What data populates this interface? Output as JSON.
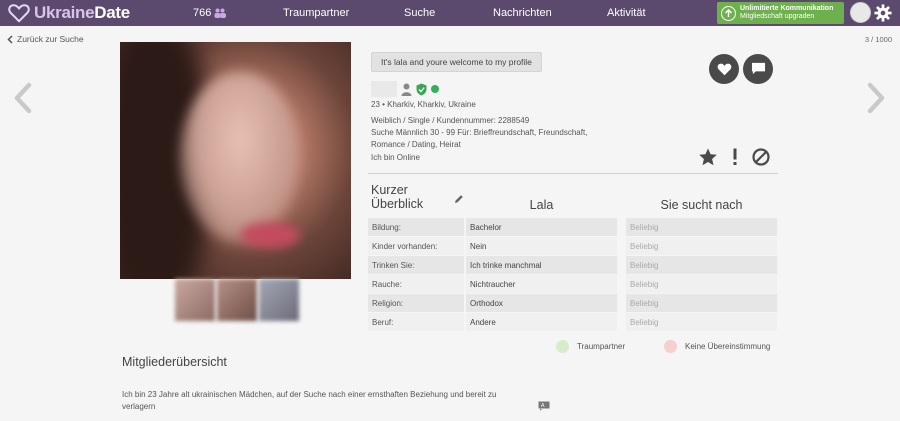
{
  "nav": {
    "logo_part1": "Ukraine",
    "logo_part2": "Date",
    "member_count": "766",
    "items": [
      "Traumpartner",
      "Suche",
      "Nachrichten",
      "Aktivität"
    ],
    "upgrade_title": "Unlimitierte Kommunikation",
    "upgrade_sub": "Mitgliedschaft upgraden"
  },
  "subnav": {
    "back_label": "Zurück zur Suche",
    "pager": "3 / 1000"
  },
  "profile": {
    "greeting": "It's lala and youre welcome to my profile",
    "location_line": "23 • Kharkiv, Kharkiv, Ukraine",
    "detail_line1": "Weiblich / Single / Kundennummer: 2288549",
    "detail_line2": "Suche Männlich 30 - 99 Für: Brieffreundschaft, Freundschaft,",
    "detail_line3": "Romance / Dating, Heirat",
    "online_text": "Ich bin Online"
  },
  "overview": {
    "title_line1": "Kurzer",
    "title_line2": "Überblick",
    "col_name": "Lala",
    "col_seeks": "Sie sucht nach",
    "rows": [
      {
        "label": "Bildung:",
        "value": "Bachelor",
        "seeks": "Beliebig"
      },
      {
        "label": "Kinder vorhanden:",
        "value": "Nein",
        "seeks": "Beliebig"
      },
      {
        "label": "Trinken Sie:",
        "value": "Ich trinke manchmal",
        "seeks": "Beliebig"
      },
      {
        "label": "Rauche:",
        "value": "Nichtraucher",
        "seeks": "Beliebig"
      },
      {
        "label": "Religion:",
        "value": "Orthodox",
        "seeks": "Beliebig"
      },
      {
        "label": "Beruf:",
        "value": "Andere",
        "seeks": "Beliebig"
      }
    ],
    "legend_match": "Traumpartner",
    "legend_nomatch": "Keine Übereinstimmung",
    "legend_match_color": "#d6eccb",
    "legend_nomatch_color": "#f6cfcf"
  },
  "member_overview": {
    "title": "Mitgliederübersicht",
    "about_line1": "Ich bin 23 Jahre alt ukrainischen Mädchen, auf der Suche nach einer ernsthaften Beziehung und bereit zu",
    "about_line2": "verlagern"
  },
  "colors": {
    "topbar": "#5c4a6e",
    "upgrade": "#6fb04e",
    "online": "#33b05a"
  }
}
